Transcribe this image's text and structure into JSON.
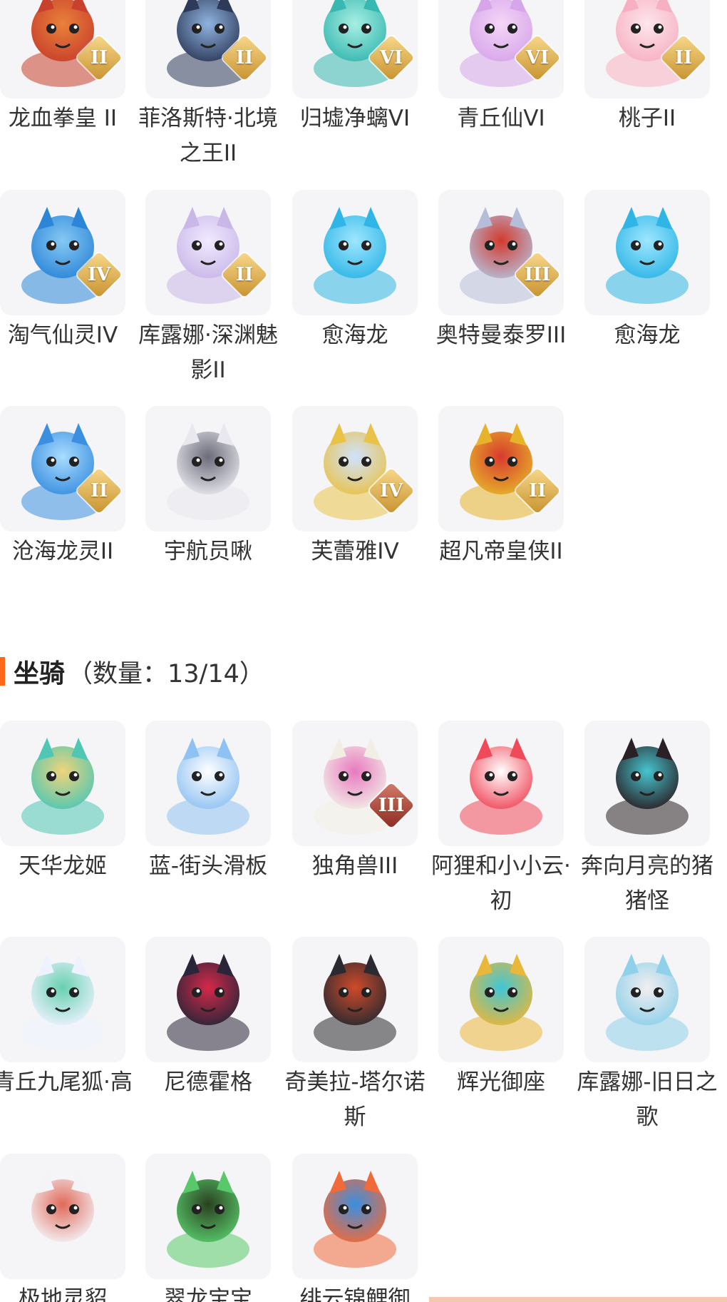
{
  "skins": {
    "items": [
      {
        "name": "龙血拳皇 II",
        "badge": "II",
        "icon": "red-beast-portrait",
        "colors": [
          "#c9402c",
          "#e9813a"
        ]
      },
      {
        "name": "菲洛斯特·北境之王II",
        "badge": "II",
        "icon": "ice-king-portrait",
        "colors": [
          "#2e3a5a",
          "#8fb4e0"
        ]
      },
      {
        "name": "归墟净螭VI",
        "badge": "VI",
        "icon": "jade-dragon-portrait",
        "colors": [
          "#37b8b0",
          "#a8efe4"
        ]
      },
      {
        "name": "青丘仙VI",
        "badge": "VI",
        "icon": "fox-fairy-portrait",
        "colors": [
          "#d7a6ea",
          "#f4d6f7"
        ]
      },
      {
        "name": "桃子II",
        "badge": "II",
        "icon": "pink-bunny-portrait",
        "colors": [
          "#f7b0c2",
          "#fde6ec"
        ]
      },
      {
        "name": "淘气仙灵IV",
        "badge": "IV",
        "icon": "blue-pup-portrait",
        "colors": [
          "#2c86d8",
          "#86c8f4"
        ]
      },
      {
        "name": "库露娜·深渊魅影II",
        "badge": "II",
        "icon": "abyss-girl-portrait",
        "colors": [
          "#c9b7e8",
          "#f1eaff"
        ]
      },
      {
        "name": "愈海龙",
        "badge": "",
        "icon": "sea-dragon-portrait",
        "colors": [
          "#2fb6e6",
          "#9fe6ff"
        ]
      },
      {
        "name": "奥特曼泰罗III",
        "badge": "III",
        "icon": "ultraman-portrait",
        "colors": [
          "#b6bdd8",
          "#d33a2e"
        ]
      },
      {
        "name": "愈海龙",
        "badge": "",
        "icon": "sea-dragon-portrait",
        "colors": [
          "#2fb6e6",
          "#9fe6ff"
        ]
      },
      {
        "name": "沧海龙灵II",
        "badge": "II",
        "icon": "dragon-spirit-portrait",
        "colors": [
          "#3a8fe0",
          "#a9dcff"
        ]
      },
      {
        "name": "宇航员啾",
        "badge": "",
        "icon": "astronaut-cow-portrait",
        "colors": [
          "#e8e8ee",
          "#6b6b7a"
        ]
      },
      {
        "name": "芙蕾雅IV",
        "badge": "IV",
        "icon": "valkyrie-portrait",
        "colors": [
          "#e9c24a",
          "#cfe3ff"
        ]
      },
      {
        "name": "超凡帝皇侠II",
        "badge": "II",
        "icon": "golden-armor-portrait",
        "colors": [
          "#e6b32a",
          "#d83a2e"
        ]
      }
    ]
  },
  "mounts": {
    "title": "坐骑",
    "count_label": "（数量：13/14）",
    "accent": "#ff6a1a",
    "items": [
      {
        "name": "天华龙姬",
        "badge": "",
        "icon": "dragon-princess-portrait",
        "colors": [
          "#4fc7b4",
          "#f0d47a"
        ]
      },
      {
        "name": "蓝-街头滑板",
        "badge": "",
        "icon": "skateboard-icon",
        "colors": [
          "#8fc1f2",
          "#ffffff"
        ]
      },
      {
        "name": "独角兽III",
        "badge": "III",
        "badge_style": "red",
        "icon": "unicorn-portrait",
        "colors": [
          "#f2eee6",
          "#e87ac0"
        ]
      },
      {
        "name": "阿狸和小小云·初",
        "badge": "",
        "icon": "ali-cloud-portrait",
        "colors": [
          "#f0495a",
          "#ffffff"
        ]
      },
      {
        "name": "奔向月亮的猪猪怪",
        "badge": "",
        "icon": "moon-pig-portrait",
        "colors": [
          "#2a2025",
          "#46c5d0"
        ]
      },
      {
        "name": "青丘九尾狐·高",
        "badge": "",
        "icon": "nine-tail-fox-portrait",
        "colors": [
          "#eef2ff",
          "#67d0b0"
        ]
      },
      {
        "name": "尼德霍格",
        "badge": "",
        "icon": "black-dragon-portrait",
        "colors": [
          "#2a2538",
          "#d6284a"
        ]
      },
      {
        "name": "奇美拉-塔尔诺斯",
        "badge": "",
        "icon": "chimera-portrait",
        "colors": [
          "#2a2a30",
          "#d04a2a"
        ]
      },
      {
        "name": "辉光御座",
        "badge": "",
        "icon": "golden-throne-portrait",
        "colors": [
          "#e9b73a",
          "#3fc6d6"
        ]
      },
      {
        "name": "库露娜-旧日之歌",
        "badge": "",
        "icon": "kuluna-song-portrait",
        "colors": [
          "#8fd0ea",
          "#f2eef0"
        ]
      },
      {
        "name": "极地灵貂",
        "badge": "",
        "icon": "polar-ferret-portrait",
        "colors": [
          "#f4f4f8",
          "#e06a5a"
        ]
      },
      {
        "name": "翠龙宝宝",
        "badge": "",
        "icon": "green-dragon-portrait",
        "colors": [
          "#58c86a",
          "#2a4020"
        ]
      },
      {
        "name": "绯云锦鲤御",
        "badge": "",
        "icon": "koi-carp-portrait",
        "colors": [
          "#f06a3a",
          "#3a8fe0"
        ]
      }
    ]
  }
}
